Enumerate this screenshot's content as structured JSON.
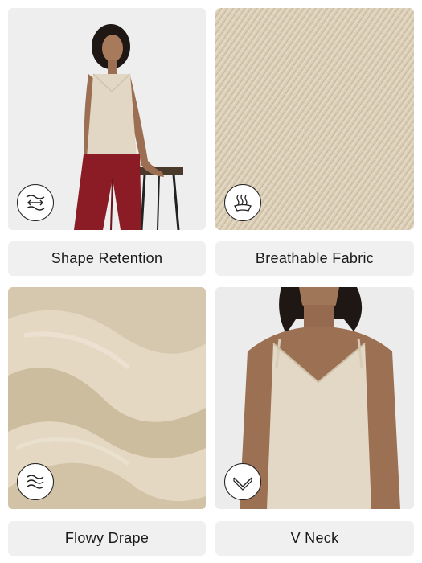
{
  "features": [
    {
      "label": "Shape Retention",
      "icon": "shape-retention-icon",
      "image": "model-wearing-cami-seated-on-stool"
    },
    {
      "label": "Breathable Fabric",
      "icon": "breathable-fabric-icon",
      "image": "fabric-twill-texture-closeup"
    },
    {
      "label": "Flowy Drape",
      "icon": "flowy-drape-icon",
      "image": "draped-fabric-closeup"
    },
    {
      "label": "V Neck",
      "icon": "v-neck-icon",
      "image": "v-neck-cami-closeup"
    }
  ],
  "colors": {
    "fabric": "#d9ccb5",
    "fabric_light": "#e6dcc9",
    "trousers": "#8b1c25",
    "label_bg": "#f0f0f0"
  }
}
